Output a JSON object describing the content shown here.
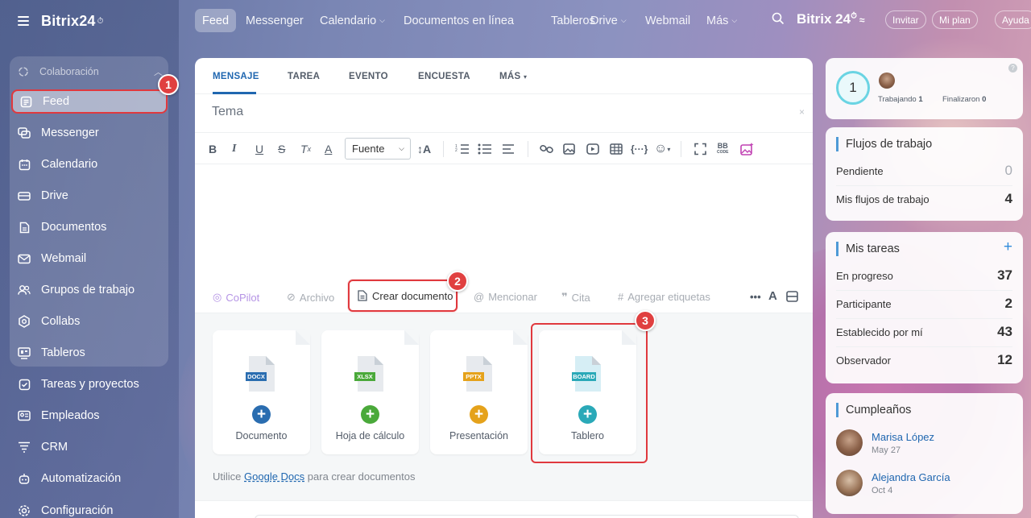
{
  "app": {
    "brand": "Bitrix24",
    "brand_mark": "⏱"
  },
  "sidebar": {
    "group_label": "Colaboración",
    "items": [
      {
        "label": "Feed",
        "icon": "feed-icon"
      },
      {
        "label": "Messenger",
        "icon": "messenger-icon"
      },
      {
        "label": "Calendario",
        "icon": "calendar-icon"
      },
      {
        "label": "Drive",
        "icon": "drive-icon"
      },
      {
        "label": "Documentos",
        "icon": "documents-icon"
      },
      {
        "label": "Webmail",
        "icon": "mail-icon"
      },
      {
        "label": "Grupos de trabajo",
        "icon": "groups-icon"
      },
      {
        "label": "Collabs",
        "icon": "collabs-icon"
      },
      {
        "label": "Tableros",
        "icon": "boards-icon"
      },
      {
        "label": "Tareas y proyectos",
        "icon": "tasks-icon"
      },
      {
        "label": "Empleados",
        "icon": "employees-icon"
      },
      {
        "label": "CRM",
        "icon": "crm-icon"
      },
      {
        "label": "Automatización",
        "icon": "automation-icon"
      },
      {
        "label": "Configuración",
        "icon": "settings-icon"
      }
    ]
  },
  "topnav": {
    "tabs": [
      "Feed",
      "Messenger",
      "Calendario",
      "Documentos en línea",
      "Tableros",
      "Drive",
      "Webmail",
      "Más"
    ],
    "brand": "Bitrix 24",
    "buttons": [
      "Invitar",
      "Mi plan",
      "Ayuda"
    ]
  },
  "composer": {
    "tabs": [
      "MENSAJE",
      "TAREA",
      "EVENTO",
      "ENCUESTA",
      "MÁS"
    ],
    "subject_placeholder": "Tema",
    "font_select": "Fuente",
    "actions": {
      "copilot": "CoPilot",
      "archivo": "Archivo",
      "crear_documento": "Crear documento",
      "mencionar": "Mencionar",
      "cita": "Cita",
      "etiquetas": "Agregar etiquetas"
    },
    "doc_types": [
      {
        "label": "Documento",
        "ext": "DOCX",
        "color": "#2a6db0"
      },
      {
        "label": "Hoja de cálculo",
        "ext": "XLSX",
        "color": "#4aa93a"
      },
      {
        "label": "Presentación",
        "ext": "PPTX",
        "color": "#e5a21b"
      },
      {
        "label": "Tablero",
        "ext": "BOARD",
        "color": "#2aa9b8"
      }
    ],
    "hint_prefix": "Utilice ",
    "hint_link": "Google Docs",
    "hint_suffix": " para crear documentos"
  },
  "callouts": [
    "1",
    "2",
    "3"
  ],
  "widgets": {
    "status": {
      "count": "1",
      "working_label": "Trabajando",
      "working": "1",
      "finished_label": "Finalizaron",
      "finished": "0"
    },
    "workflows": {
      "title": "Flujos de trabajo",
      "rows": [
        {
          "label": "Pendiente",
          "value": "0"
        },
        {
          "label": "Mis flujos de trabajo",
          "value": "4"
        }
      ]
    },
    "tasks": {
      "title": "Mis tareas",
      "rows": [
        {
          "label": "En progreso",
          "value": "37"
        },
        {
          "label": "Participante",
          "value": "2"
        },
        {
          "label": "Establecido por mí",
          "value": "43"
        },
        {
          "label": "Observador",
          "value": "12"
        }
      ]
    },
    "birthdays": {
      "title": "Cumpleaños",
      "people": [
        {
          "name": "Marisa López",
          "date": "May 27"
        },
        {
          "name": "Alejandra García",
          "date": "Oct 4"
        }
      ]
    }
  }
}
